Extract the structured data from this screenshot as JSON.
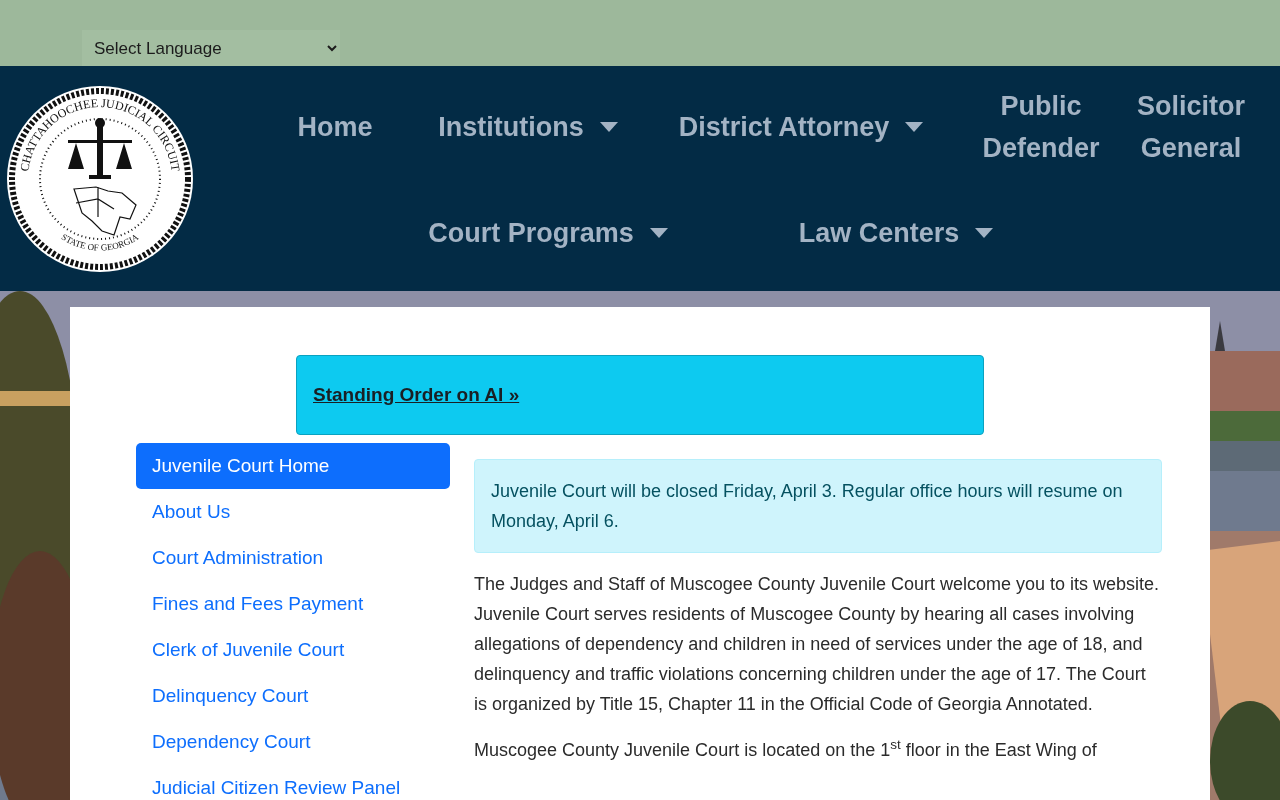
{
  "language_select": {
    "value": "Select Language"
  },
  "logo": {
    "ring_text": "CHATTAHOOCHEE JUDICIAL CIRCUIT",
    "bottom_text": "STATE OF GEORGIA"
  },
  "nav": {
    "items": [
      {
        "label": "Home",
        "dropdown": false
      },
      {
        "label": "Institutions",
        "dropdown": true
      },
      {
        "label": "District Attorney",
        "dropdown": true
      },
      {
        "label": "Public Defender",
        "dropdown": false
      },
      {
        "label": "Solicitor General",
        "dropdown": false
      },
      {
        "label": "Court Programs",
        "dropdown": true
      },
      {
        "label": "Law Centers",
        "dropdown": true
      }
    ]
  },
  "banner": {
    "link": "Standing Order on AI »"
  },
  "sidebar": {
    "items": [
      {
        "label": "Juvenile Court Home",
        "selected": true
      },
      {
        "label": "About Us",
        "selected": false
      },
      {
        "label": "Court Administration",
        "selected": false
      },
      {
        "label": "Fines and Fees Payment",
        "selected": false
      },
      {
        "label": "Clerk of Juvenile Court",
        "selected": false
      },
      {
        "label": "Delinquency Court",
        "selected": false
      },
      {
        "label": "Dependency Court",
        "selected": false
      },
      {
        "label": "Judicial Citizen Review Panel",
        "selected": false
      }
    ]
  },
  "notice": "Juvenile Court will be closed Friday, April 3. Regular office hours will resume on Monday, April 6.",
  "paragraphs": [
    "The Judges and Staff of Muscogee County Juvenile Court welcome you to its website. Juvenile Court serves residents of Muscogee County by hearing all cases involving allegations of dependency and children in need of services under the age of 18, and delinquency and traffic violations concerning children under the age of 17. The Court is organized by Title 15, Chapter 11 in the Official Code of Georgia Annotated.",
    "Muscogee County Juvenile Court is located on the 1$^{st}$ floor in the East Wing of"
  ]
}
